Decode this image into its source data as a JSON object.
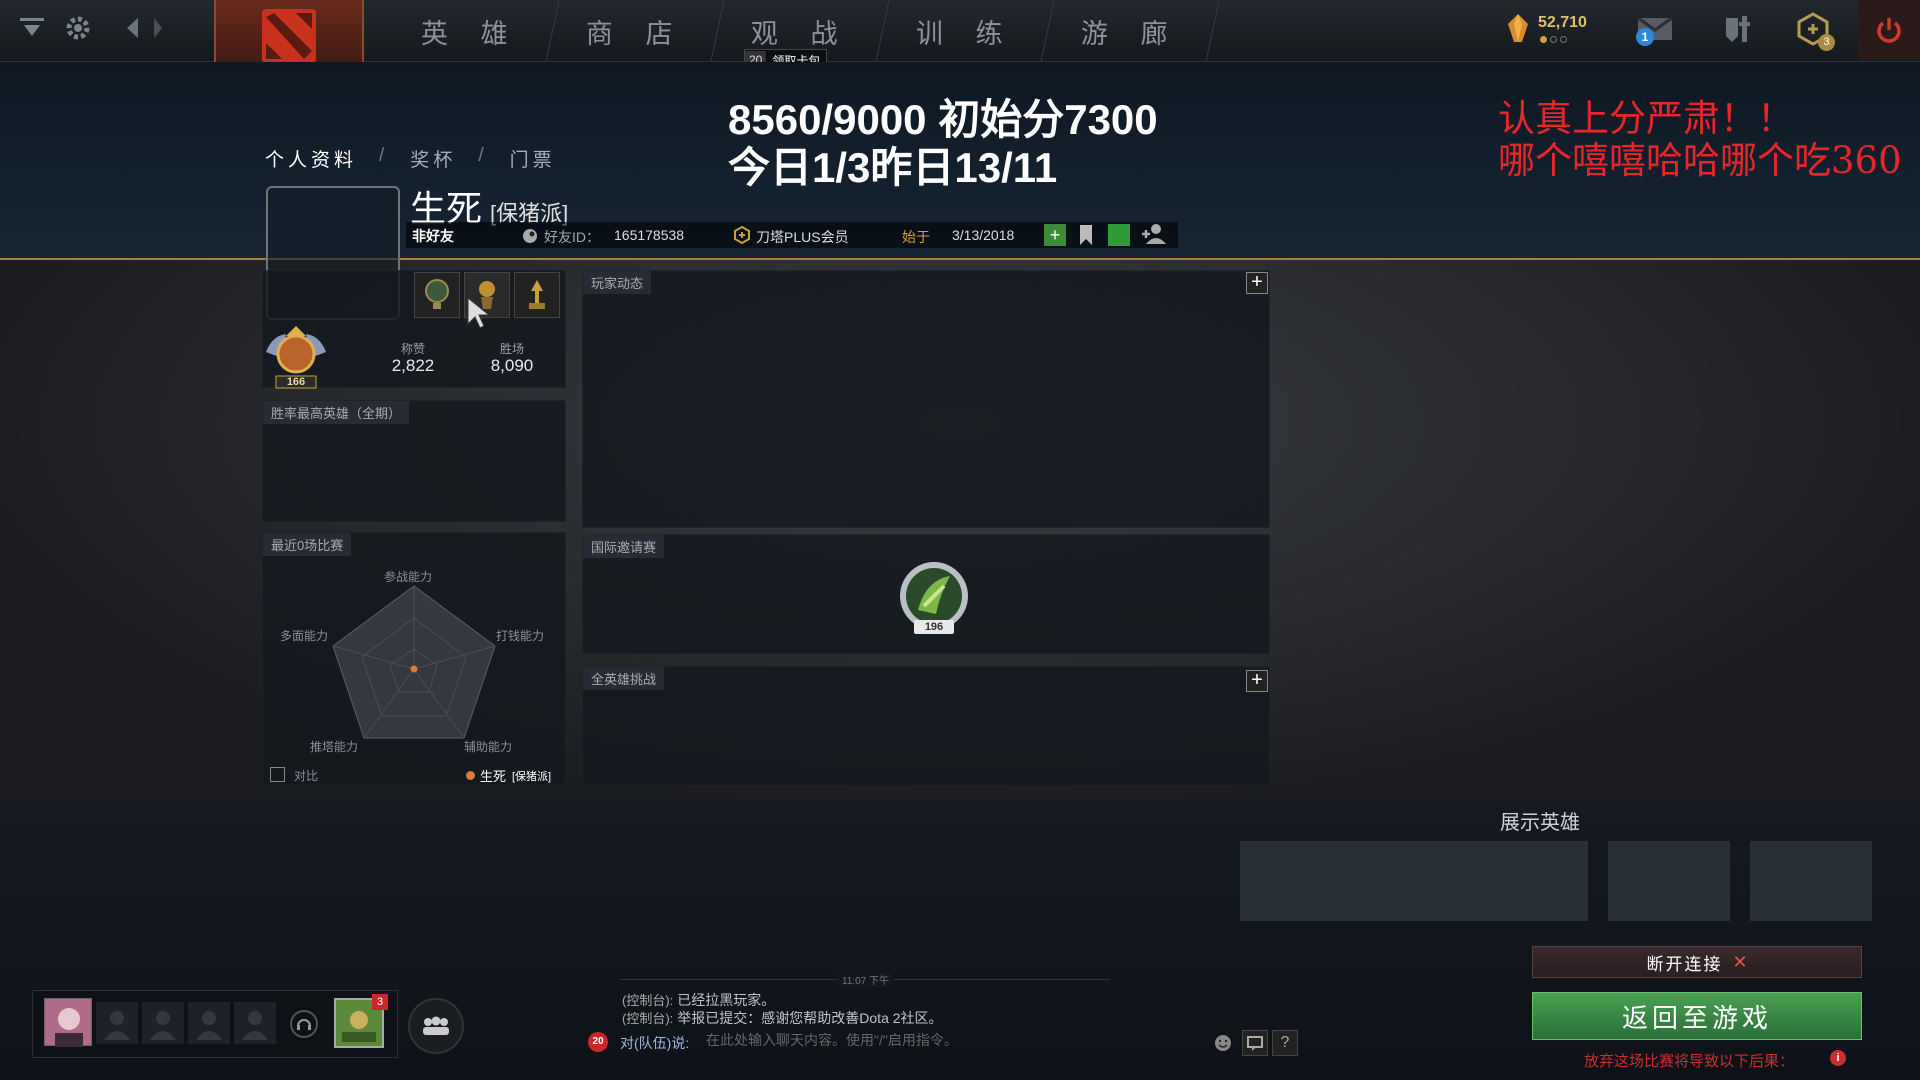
{
  "nav": {
    "tabs": [
      "英 雄",
      "商 店",
      "观 战",
      "训 练",
      "游 廊"
    ],
    "battlepass_badge": "20",
    "battlepass_label": "领取卡包",
    "shards": "52,710",
    "mail_count": "1",
    "plus_count": "3"
  },
  "overlay": {
    "line1": "8560/9000 初始分7300",
    "line2": "今日1/3昨日13/11",
    "red1": "认真上分严肃！！",
    "red2": "哪个嘻嘻哈哈哪个吃360"
  },
  "breadcrumb": [
    "个人资料",
    "/",
    "奖杯",
    "/",
    "门票"
  ],
  "profile": {
    "name": "生死",
    "tag": "[保猪派]",
    "relation": "非好友",
    "friend_id_label": "好友ID：",
    "friend_id": "165178538",
    "plus_label": "刀塔PLUS会员",
    "since_label": "始于",
    "since_date": "3/13/2018",
    "level": "166",
    "commends_label": "称赞",
    "commends": "2,822",
    "wins_label": "胜场",
    "wins": "8,090"
  },
  "panels": {
    "activity": "玩家动态",
    "best_heroes": "胜率最高英雄（全期）",
    "recent_matches": "最近0场比赛",
    "ti": "国际邀请赛",
    "ti_level": "196",
    "hero_challenge": "全英雄挑战",
    "showcase": "展示英雄"
  },
  "radar": {
    "axes": [
      "参战能力",
      "打钱能力",
      "辅助能力",
      "推塔能力",
      "多面能力"
    ],
    "compare_label": "对比",
    "legend_name": "生死",
    "legend_tag": "[保猪派]"
  },
  "chat": {
    "time": "11:07 下午",
    "lines": [
      {
        "prefix": "(控制台):",
        "text": "已经拉黑玩家。"
      },
      {
        "prefix": "(控制台):",
        "text": "举报已提交：感谢您帮助改善Dota 2社区。"
      }
    ],
    "badge": "20",
    "channel": "对(队伍)说:",
    "placeholder": "在此处输入聊天内容。使用\"/\"启用指令。"
  },
  "party": {
    "notif": "3"
  },
  "actions": {
    "disconnect": "断开连接",
    "return": "返回至游戏",
    "abandon_warning": "放弃这场比赛将导致以下后果："
  },
  "colors": {
    "accent_gold": "#a8803c",
    "red_text": "#e8262a",
    "green_button": "#3c8a4a"
  }
}
